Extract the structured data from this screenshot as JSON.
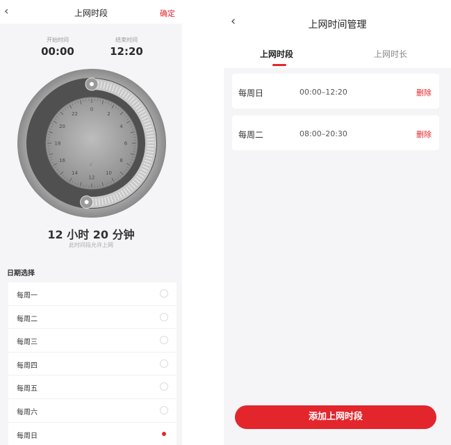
{
  "left_screen": {
    "header": {
      "back_icon": "‹",
      "title": "上网时段",
      "confirm": "确定"
    },
    "start": {
      "label": "开始时间",
      "value": "00:00"
    },
    "end": {
      "label": "结束时间",
      "value": "12:20"
    },
    "dial": {
      "numbers": [
        "0",
        "2",
        "4",
        "6",
        "8",
        "10",
        "12",
        "14",
        "16",
        "18",
        "20",
        "22"
      ],
      "range_start_hour": 0,
      "range_end_hour": 12.333,
      "start_icon": "sun-icon",
      "end_icon": "moon-icon",
      "center_icon": "moon-icon"
    },
    "duration": "12 小时 20 分钟",
    "duration_note": "此时间段允许上网",
    "date_section_title": "日期选择",
    "days": [
      {
        "label": "每周一",
        "selected": false
      },
      {
        "label": "每周二",
        "selected": false
      },
      {
        "label": "每周三",
        "selected": false
      },
      {
        "label": "每周四",
        "selected": false
      },
      {
        "label": "每周五",
        "selected": false
      },
      {
        "label": "每周六",
        "selected": false
      },
      {
        "label": "每周日",
        "selected": true
      }
    ]
  },
  "right_screen": {
    "header": {
      "back_icon": "‹",
      "title": "上网时间管理"
    },
    "tabs": [
      {
        "label": "上网时段",
        "active": true
      },
      {
        "label": "上网时长",
        "active": false
      }
    ],
    "entries": [
      {
        "day": "每周日",
        "time": "00:00–12:20",
        "delete": "删除"
      },
      {
        "day": "每周二",
        "time": "08:00–20:30",
        "delete": "删除"
      }
    ],
    "add_button": "添加上网时段"
  },
  "colors": {
    "accent": "#e3262c",
    "bg": "#f5f5f7"
  }
}
